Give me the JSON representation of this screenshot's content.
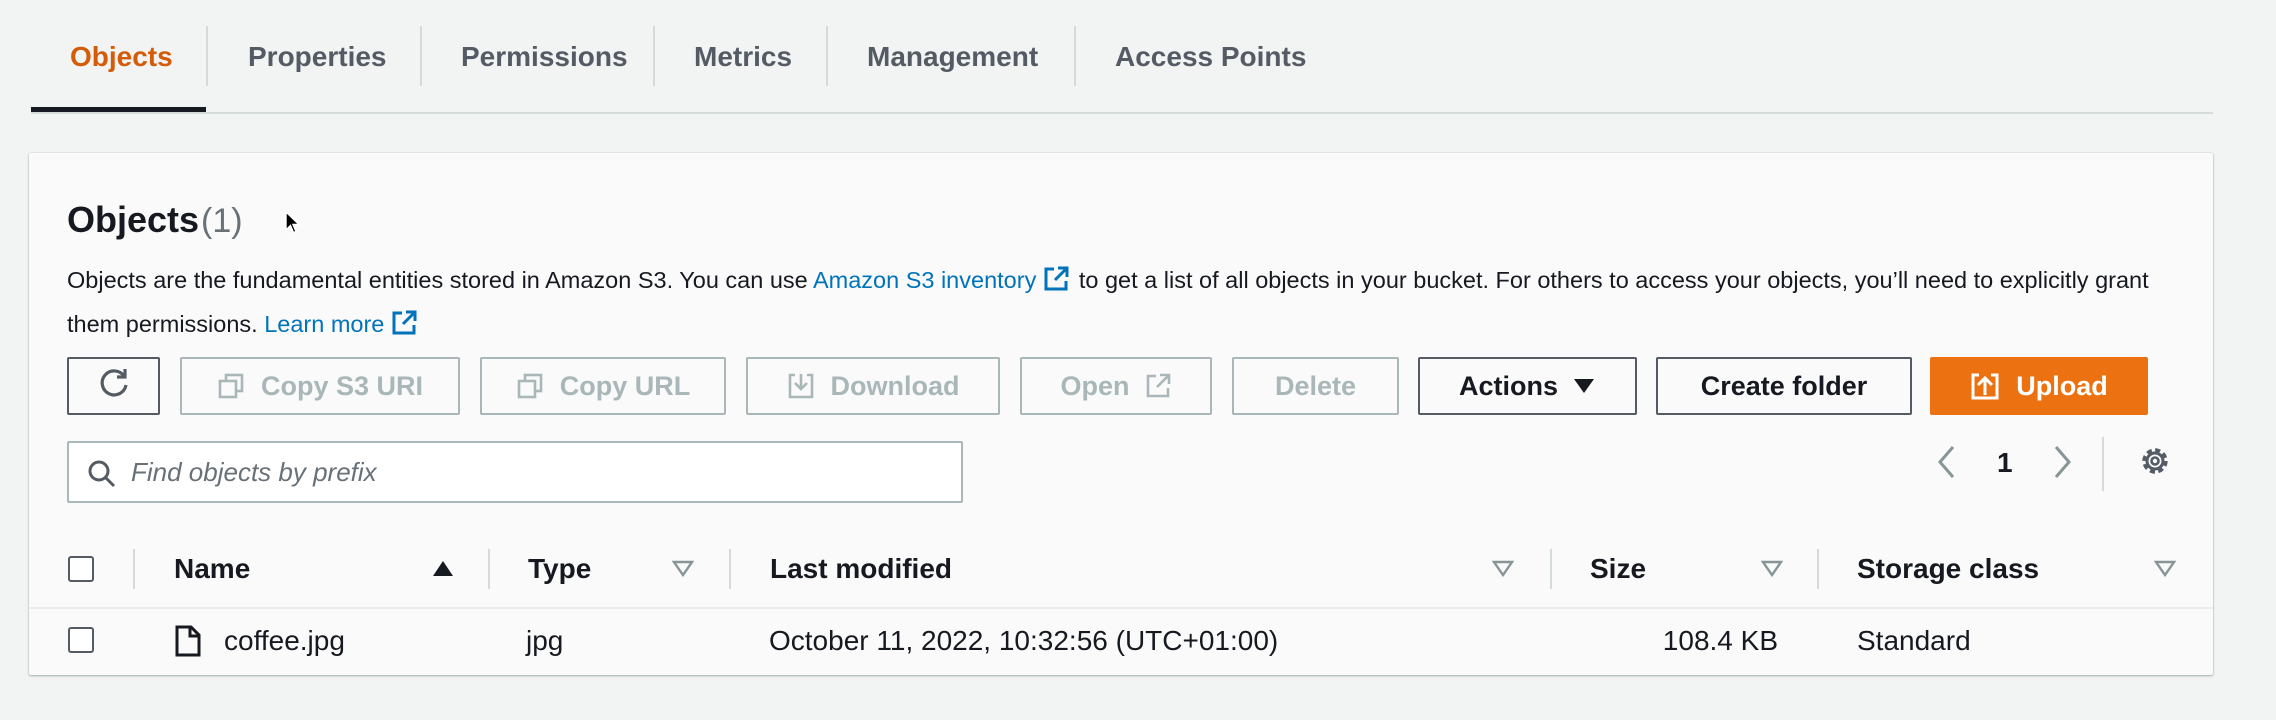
{
  "tabs": [
    {
      "label": "Objects",
      "active": true
    },
    {
      "label": "Properties",
      "active": false
    },
    {
      "label": "Permissions",
      "active": false
    },
    {
      "label": "Metrics",
      "active": false
    },
    {
      "label": "Management",
      "active": false
    },
    {
      "label": "Access Points",
      "active": false
    }
  ],
  "panel": {
    "title": "Objects",
    "count": "(1)",
    "description": {
      "part1": "Objects are the fundamental entities stored in Amazon S3. You can use ",
      "link1": "Amazon S3 inventory",
      "part2": " to get a list of all objects in your bucket. For others to access your objects, you’ll need to explicitly grant them permissions. ",
      "link2": "Learn more"
    }
  },
  "toolbar": {
    "copy_s3_uri": "Copy S3 URI",
    "copy_url": "Copy URL",
    "download": "Download",
    "open": "Open",
    "delete": "Delete",
    "actions": "Actions",
    "create_folder": "Create folder",
    "upload": "Upload"
  },
  "search": {
    "placeholder": "Find objects by prefix",
    "value": ""
  },
  "pagination": {
    "current_page": "1"
  },
  "table": {
    "columns": [
      "Name",
      "Type",
      "Last modified",
      "Size",
      "Storage class"
    ],
    "rows": [
      {
        "name": "coffee.jpg",
        "type": "jpg",
        "last_modified": "October 11, 2022, 10:32:56 (UTC+01:00)",
        "size": "108.4 KB",
        "storage_class": "Standard"
      }
    ]
  },
  "colors": {
    "accent": "#ec7211",
    "active_tab": "#d45b07",
    "link": "#0073bb",
    "disabled": "#aab7b8"
  },
  "icons": [
    "refresh-icon",
    "copy-icon",
    "download-icon",
    "external-link-icon",
    "caret-down-icon",
    "upload-icon",
    "search-icon",
    "chevron-left-icon",
    "chevron-right-icon",
    "gear-icon",
    "sort-ascending-icon",
    "sort-icon",
    "file-icon"
  ]
}
